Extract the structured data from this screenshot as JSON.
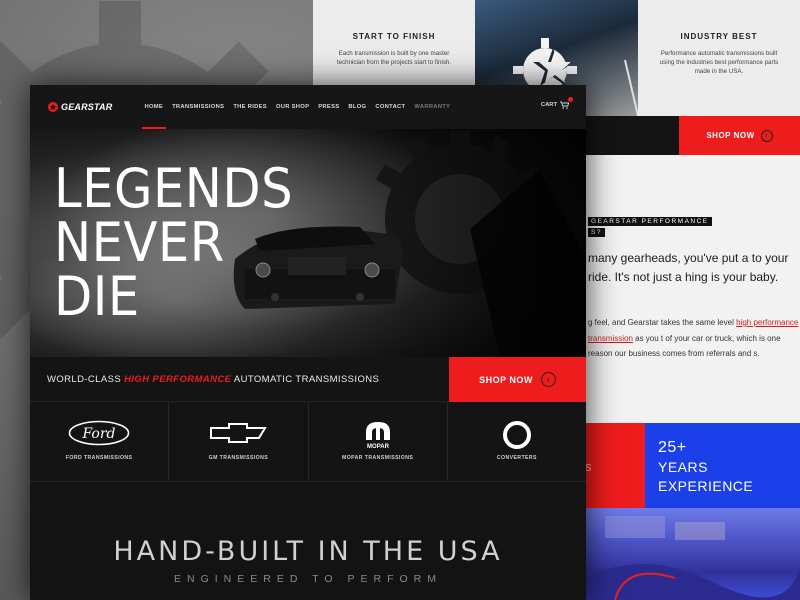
{
  "background": {
    "card_start": {
      "title": "START TO FINISH",
      "text": "Each transmission is built by one master technician from the projects start to finish."
    },
    "card_industry": {
      "title": "INDUSTRY BEST",
      "text": "Performance automatic transmissions built using the industries best performance parts made in the USA."
    },
    "shop_now": "SHOP NOW",
    "about": {
      "tag_line1": "GEARSTAR PERFORMANCE",
      "tag_line2": "S?",
      "lead": "many gearheads, you've put a to your ride. It's not just a hing is your baby.",
      "body_before": "g feel, and Gearstar takes the same level",
      "body_link": "high performance transmission",
      "body_after": " as you t of your car or truck, which is one reason our business comes from referrals and s."
    },
    "red_box_text": "s",
    "years": {
      "number": "25+",
      "label_line1": "YEARS",
      "label_line2": "EXPERIENCE"
    }
  },
  "site": {
    "logo": "GEARSTAR",
    "nav": [
      {
        "label": "HOME",
        "active": true
      },
      {
        "label": "TRANSMISSIONS"
      },
      {
        "label": "THE RIDES"
      },
      {
        "label": "OUR SHOP"
      },
      {
        "label": "PRESS"
      },
      {
        "label": "BLOG"
      },
      {
        "label": "CONTACT"
      },
      {
        "label": "WARRANTY",
        "muted": true
      }
    ],
    "cart_label": "CART",
    "hero": {
      "line1": "LEGENDS",
      "line2": "NEVER",
      "line3": "DIE"
    },
    "tagline": {
      "before": "WORLD-CLASS ",
      "highlight": "HIGH PERFORMANCE",
      "after": " AUTOMATIC TRANSMISSIONS"
    },
    "shop_now": "SHOP NOW",
    "brands": [
      {
        "label": "FORD TRANSMISSIONS",
        "icon": "ford-logo-icon",
        "logo_text": "Ford"
      },
      {
        "label": "GM TRANSMISSIONS",
        "icon": "chevrolet-bowtie-icon"
      },
      {
        "label": "MOPAR TRANSMISSIONS",
        "icon": "mopar-logo-icon",
        "logo_text": "MOPAR"
      },
      {
        "label": "CONVERTERS",
        "icon": "torque-converter-icon"
      }
    ],
    "handbuilt": {
      "title": "HAND-BUILT IN THE USA",
      "subtitle": "ENGINEERED TO PERFORM"
    }
  },
  "colors": {
    "accent_red": "#ee1c1c",
    "accent_blue": "#1b3fe8",
    "dark": "#141414"
  }
}
